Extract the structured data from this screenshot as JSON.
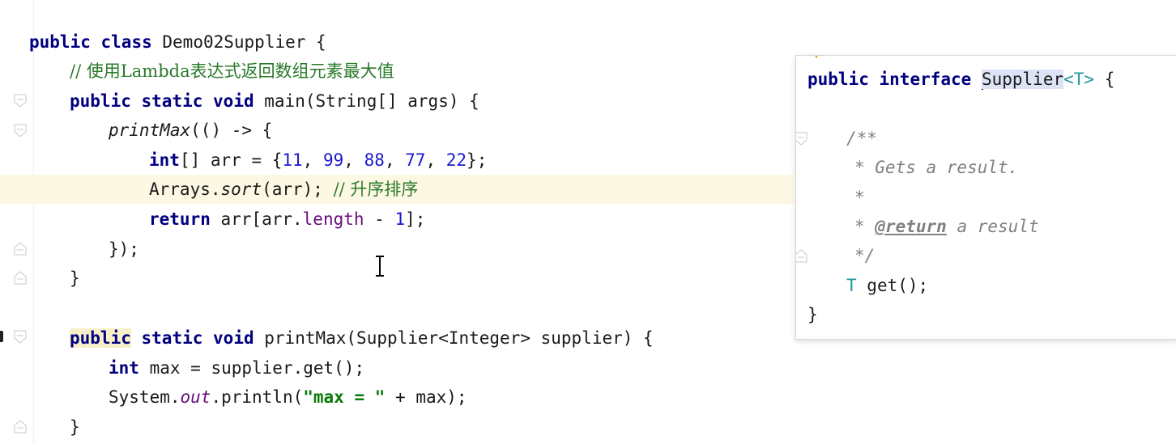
{
  "editor": {
    "lines": {
      "l1": {
        "kw1": "public",
        "kw2": "class",
        "rest": "Demo02Supplier {"
      },
      "l2": {
        "comment": "// 使用Lambda表达式返回数组元素最大值"
      },
      "l3": {
        "kw1": "public",
        "kw2": "static",
        "kw3": "void",
        "rest": "main(String[] args) {"
      },
      "l4": {
        "method": "printMax",
        "rest": "(() -> {"
      },
      "l5": {
        "kw": "int",
        "a": "[] arr = {",
        "n1": "11",
        "s1": ", ",
        "n2": "99",
        "s2": ", ",
        "n3": "88",
        "s3": ", ",
        "n4": "77",
        "s4": ", ",
        "n5": "22",
        "end": "};"
      },
      "l6": {
        "a": "Arrays.",
        "method": "sort",
        "b": "(arr); ",
        "comment": "// 升序排序"
      },
      "l7": {
        "kw": "return",
        "a": " arr[arr.",
        "field": "length",
        "b": " - ",
        "num": "1",
        "c": "];"
      },
      "l8": {
        "text": "});"
      },
      "l9": {
        "text": "}"
      },
      "l10": {
        "kw1": "public",
        "kw2": "static",
        "kw3": "void",
        "rest": "printMax(Supplier<Integer> supplier) {"
      },
      "l11": {
        "kw": "int",
        "rest": " max = supplier.get();"
      },
      "l12": {
        "a": "System.",
        "field": "out",
        "b": ".println(",
        "str": "\"max = \"",
        "c": " + max);"
      },
      "l13": {
        "text": "}"
      }
    }
  },
  "popup": {
    "l1": {
      "kw1": "public",
      "kw2": "interface",
      "name": "Supplier",
      "tp": "<T>",
      "end": " {"
    },
    "l2": {
      "text": "/**"
    },
    "l3": {
      "text": "* Gets a result."
    },
    "l4": {
      "text": "*"
    },
    "l5": {
      "star": "* ",
      "tag": "@return",
      "rest": " a result"
    },
    "l6": {
      "text": "*/"
    },
    "l7": {
      "tp": "T",
      "rest": " get();"
    },
    "l8": {
      "text": "}"
    }
  },
  "colors": {
    "keyword": "#000080",
    "comment": "#2a7a2a",
    "number": "#1a1acc",
    "string": "#0a7a0a",
    "field": "#660e7a",
    "type_param": "#20999d",
    "caret_row": "#fdf8e3"
  }
}
